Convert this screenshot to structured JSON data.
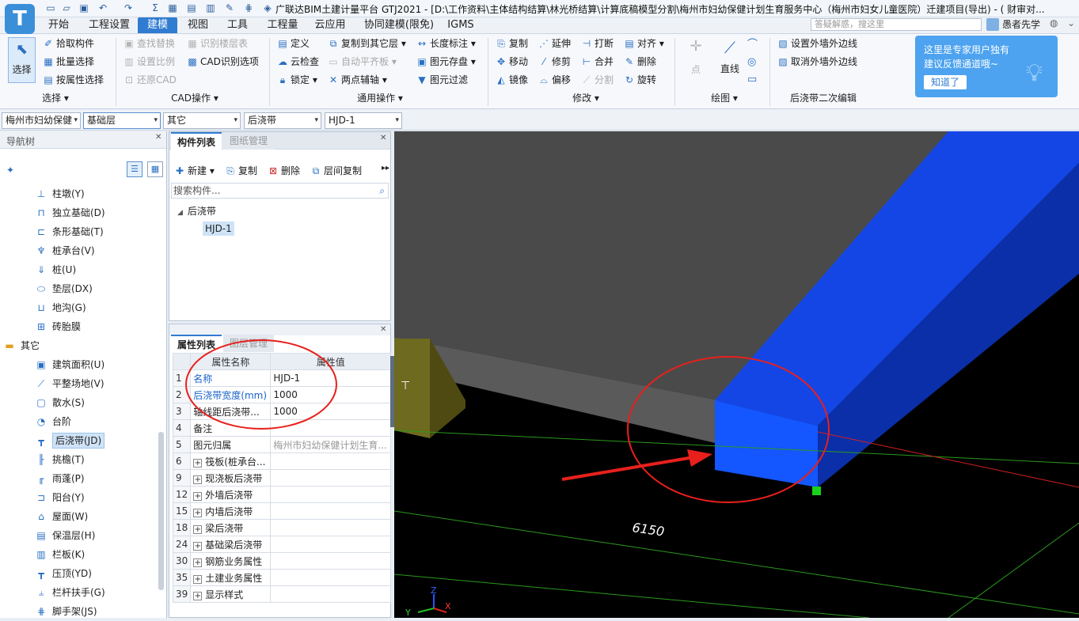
{
  "app": {
    "logo": "T",
    "title": "广联达BIM土建计量平台 GTJ2021 - [D:\\工作资料\\主体结构结算\\林光桥结算\\计算底稿模型分割\\梅州市妇幼保健计划生育服务中心（梅州市妇女儿童医院）迁建项目(导出) - ( 财审对..."
  },
  "ribbon_tabs": [
    "开始",
    "工程设置",
    "建模",
    "视图",
    "工具",
    "工程量",
    "云应用",
    "协同建模(限免)",
    "IGMS"
  ],
  "active_tab": "建模",
  "help_search_placeholder": "答疑解惑，搜这里",
  "user_name": "愚者先学",
  "ribbon": {
    "select_label": "选择",
    "select_group": [
      "拾取构件",
      "批量选择",
      "按属性选择"
    ],
    "cad_group": [
      "查找替换",
      "设置比例",
      "还原CAD",
      "识别楼层表",
      "CAD识别选项"
    ],
    "general_group": [
      "定义",
      "云检查",
      "锁定",
      "复制到其它层",
      "自动平齐板",
      "两点辅轴",
      "长度标注",
      "图元存盘",
      "图元过滤"
    ],
    "modify_group": [
      "复制",
      "移动",
      "镜像",
      "延伸",
      "修剪",
      "偏移",
      "打断",
      "合并",
      "分割",
      "对齐",
      "删除",
      "旋转"
    ],
    "draw_group": [
      "点",
      "直线"
    ],
    "post_group": [
      "设置外墙外边线",
      "取消外墙外边线"
    ],
    "group_labels": [
      "选择",
      "CAD操作",
      "通用操作",
      "修改",
      "绘图",
      "后浇带二次编辑"
    ]
  },
  "tip": {
    "line1": "这里是专家用户独有",
    "line2": "建议反馈通道哦~",
    "button": "知道了"
  },
  "filters": [
    "梅州市妇幼保健",
    "基础层",
    "其它",
    "后浇带",
    "HJD-1"
  ],
  "nav": {
    "title": "导航树",
    "items": [
      "柱墩(Y)",
      "独立基础(D)",
      "条形基础(T)",
      "桩承台(V)",
      "桩(U)",
      "垫层(DX)",
      "地沟(G)",
      "砖胎膜"
    ],
    "category": "其它",
    "other_items": [
      "建筑面积(U)",
      "平整场地(V)",
      "散水(S)",
      "台阶",
      "后浇带(JD)",
      "挑檐(T)",
      "雨蓬(P)",
      "阳台(Y)",
      "屋面(W)",
      "保温层(H)",
      "栏板(K)",
      "压顶(YD)",
      "栏杆扶手(G)",
      "脚手架(JS)"
    ],
    "selected": "后浇带(JD)"
  },
  "components": {
    "tabs": [
      "构件列表",
      "图纸管理"
    ],
    "toolbar": [
      "新建",
      "复制",
      "删除",
      "层间复制"
    ],
    "search_placeholder": "搜索构件...",
    "tree_root": "后浇带",
    "tree_child": "HJD-1"
  },
  "properties": {
    "tabs": [
      "属性列表",
      "图层管理"
    ],
    "header": [
      "属性名称",
      "属性值"
    ],
    "rows": [
      {
        "n": "1",
        "k": "名称",
        "v": "HJD-1"
      },
      {
        "n": "2",
        "k": "后浇带宽度(mm)",
        "v": "1000"
      },
      {
        "n": "3",
        "k": "轴线距后浇带...",
        "v": "1000"
      },
      {
        "n": "4",
        "k": "备注",
        "v": ""
      },
      {
        "n": "5",
        "k": "图元归属",
        "v": "梅州市妇幼保健计划生育..."
      },
      {
        "n": "6",
        "k": "筏板(桩承台...",
        "v": ""
      },
      {
        "n": "9",
        "k": "现浇板后浇带",
        "v": ""
      },
      {
        "n": "12",
        "k": "外墙后浇带",
        "v": ""
      },
      {
        "n": "15",
        "k": "内墙后浇带",
        "v": ""
      },
      {
        "n": "18",
        "k": "梁后浇带",
        "v": ""
      },
      {
        "n": "24",
        "k": "基础梁后浇带",
        "v": ""
      },
      {
        "n": "30",
        "k": "钢筋业务属性",
        "v": ""
      },
      {
        "n": "35",
        "k": "土建业务属性",
        "v": ""
      },
      {
        "n": "39",
        "k": "显示样式",
        "v": ""
      }
    ]
  },
  "viewport": {
    "dimension_label": "6150",
    "axis_x": "X",
    "axis_y": "Y",
    "axis_z": "Z",
    "band_color": "#1446e6",
    "slab_color": "#4a4a4a",
    "annotation_color": "#e8201c"
  }
}
